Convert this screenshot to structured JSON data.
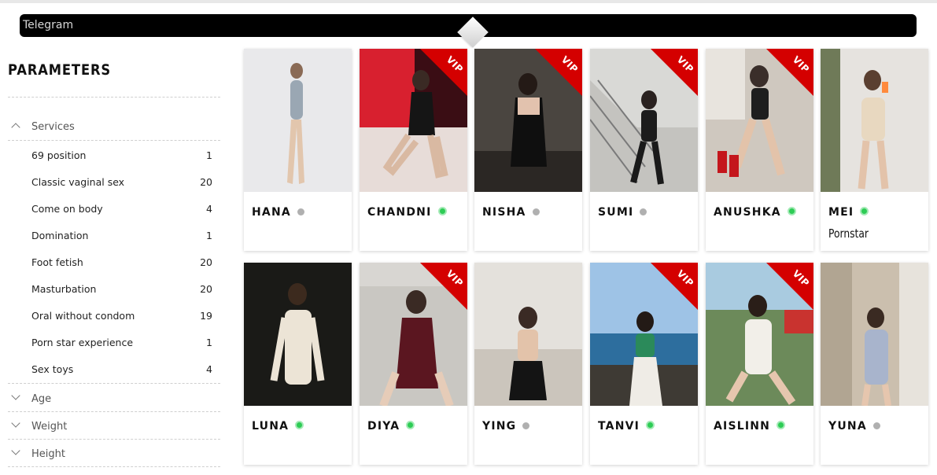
{
  "telegram_bar": {
    "label": "Telegram"
  },
  "sidebar": {
    "title": "PARAMETERS",
    "groups": [
      {
        "label": "Services",
        "expanded": true
      },
      {
        "label": "Age",
        "expanded": false
      },
      {
        "label": "Weight",
        "expanded": false
      },
      {
        "label": "Height",
        "expanded": false
      }
    ],
    "services": [
      {
        "label": "69 position",
        "count": "1"
      },
      {
        "label": "Classic vaginal sex",
        "count": "20"
      },
      {
        "label": "Come on body",
        "count": "4"
      },
      {
        "label": "Domination",
        "count": "1"
      },
      {
        "label": "Foot fetish",
        "count": "20"
      },
      {
        "label": "Masturbation",
        "count": "20"
      },
      {
        "label": "Oral without condom",
        "count": "19"
      },
      {
        "label": "Porn star experience",
        "count": "1"
      },
      {
        "label": "Sex toys",
        "count": "4"
      }
    ]
  },
  "vip_label": "VIP",
  "status_colors": {
    "online": "#2ecc55",
    "offline": "#b0b0b0"
  },
  "profiles": [
    {
      "name": "HANA",
      "online": false,
      "vip": false,
      "tag": ""
    },
    {
      "name": "CHANDNI",
      "online": true,
      "vip": true,
      "tag": ""
    },
    {
      "name": "NISHA",
      "online": false,
      "vip": true,
      "tag": ""
    },
    {
      "name": "SUMI",
      "online": false,
      "vip": true,
      "tag": ""
    },
    {
      "name": "ANUSHKA",
      "online": true,
      "vip": true,
      "tag": ""
    },
    {
      "name": "MEI",
      "online": true,
      "vip": false,
      "tag": "Pornstar"
    },
    {
      "name": "LUNA",
      "online": true,
      "vip": false,
      "tag": ""
    },
    {
      "name": "DIYA",
      "online": true,
      "vip": true,
      "tag": ""
    },
    {
      "name": "YING",
      "online": false,
      "vip": false,
      "tag": ""
    },
    {
      "name": "TANVI",
      "online": true,
      "vip": true,
      "tag": ""
    },
    {
      "name": "AISLINN",
      "online": true,
      "vip": true,
      "tag": ""
    },
    {
      "name": "YUNA",
      "online": false,
      "vip": false,
      "tag": ""
    }
  ]
}
